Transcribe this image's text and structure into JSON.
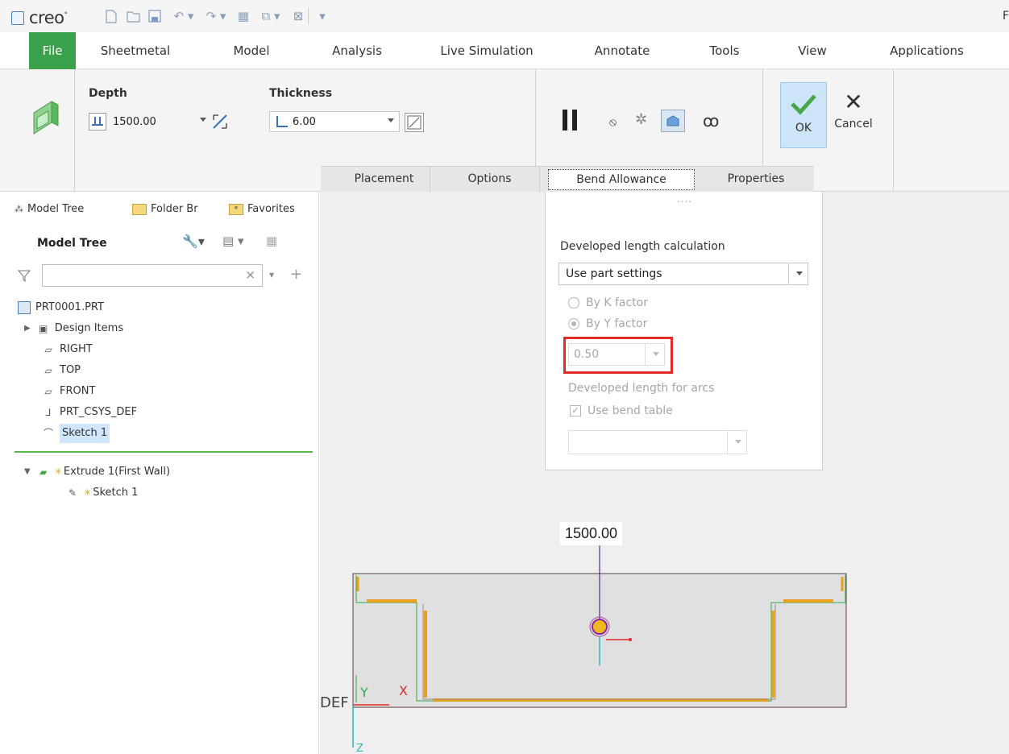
{
  "app": {
    "logo_text": "creo",
    "logo_mark": "°"
  },
  "quick_access": {
    "icons": [
      "new-icon",
      "open-icon",
      "save-icon",
      "undo-icon",
      "redo-icon",
      "regenerate-icon",
      "windows-icon",
      "close-window-icon",
      "customize-icon"
    ],
    "right_edge_text": "F"
  },
  "tabs": [
    {
      "label": "File"
    },
    {
      "label": "Sheetmetal"
    },
    {
      "label": "Model"
    },
    {
      "label": "Analysis"
    },
    {
      "label": "Live Simulation"
    },
    {
      "label": "Annotate"
    },
    {
      "label": "Tools"
    },
    {
      "label": "View"
    },
    {
      "label": "Applications"
    }
  ],
  "dashboard": {
    "depth_label": "Depth",
    "depth_value": "1500.00",
    "thickness_label": "Thickness",
    "thickness_value": "6.00",
    "ok_label": "OK",
    "cancel_label": "Cancel",
    "subtabs": [
      "Placement",
      "Options",
      "Bend Allowance",
      "Properties"
    ]
  },
  "left_panel": {
    "tabs": [
      "Model Tree",
      "Folder Br",
      "Favorites"
    ],
    "title": "Model Tree",
    "filter_placeholder": "",
    "items": [
      {
        "label": "PRT0001.PRT"
      },
      {
        "label": "Design Items"
      },
      {
        "label": "RIGHT"
      },
      {
        "label": "TOP"
      },
      {
        "label": "FRONT"
      },
      {
        "label": "PRT_CSYS_DEF"
      },
      {
        "label": "Sketch 1"
      }
    ],
    "feature_items": [
      {
        "label": "Extrude 1(First Wall)"
      },
      {
        "label": "Sketch 1"
      }
    ]
  },
  "bend_panel": {
    "heading": "Developed length calculation",
    "method_value": "Use part settings",
    "k_factor_label": "By K factor",
    "y_factor_label": "By Y factor",
    "factor_value": "0.50",
    "arcs_label": "Developed length for arcs",
    "bend_table_label": "Use bend table",
    "grip_dots": "...."
  },
  "graphics": {
    "dimension_label": "1500.00",
    "axis_x": "X",
    "axis_y": "Y",
    "axis_z": "Z",
    "csys_fragment": "DEF"
  },
  "colors": {
    "file_tab": "#3aa14a",
    "highlight_box": "#e52a2a",
    "ok_bg": "#cde6f7",
    "ok_check": "#4aa64a",
    "edge_orange": "#e8a01c",
    "sketch_green": "#2faa4a"
  }
}
